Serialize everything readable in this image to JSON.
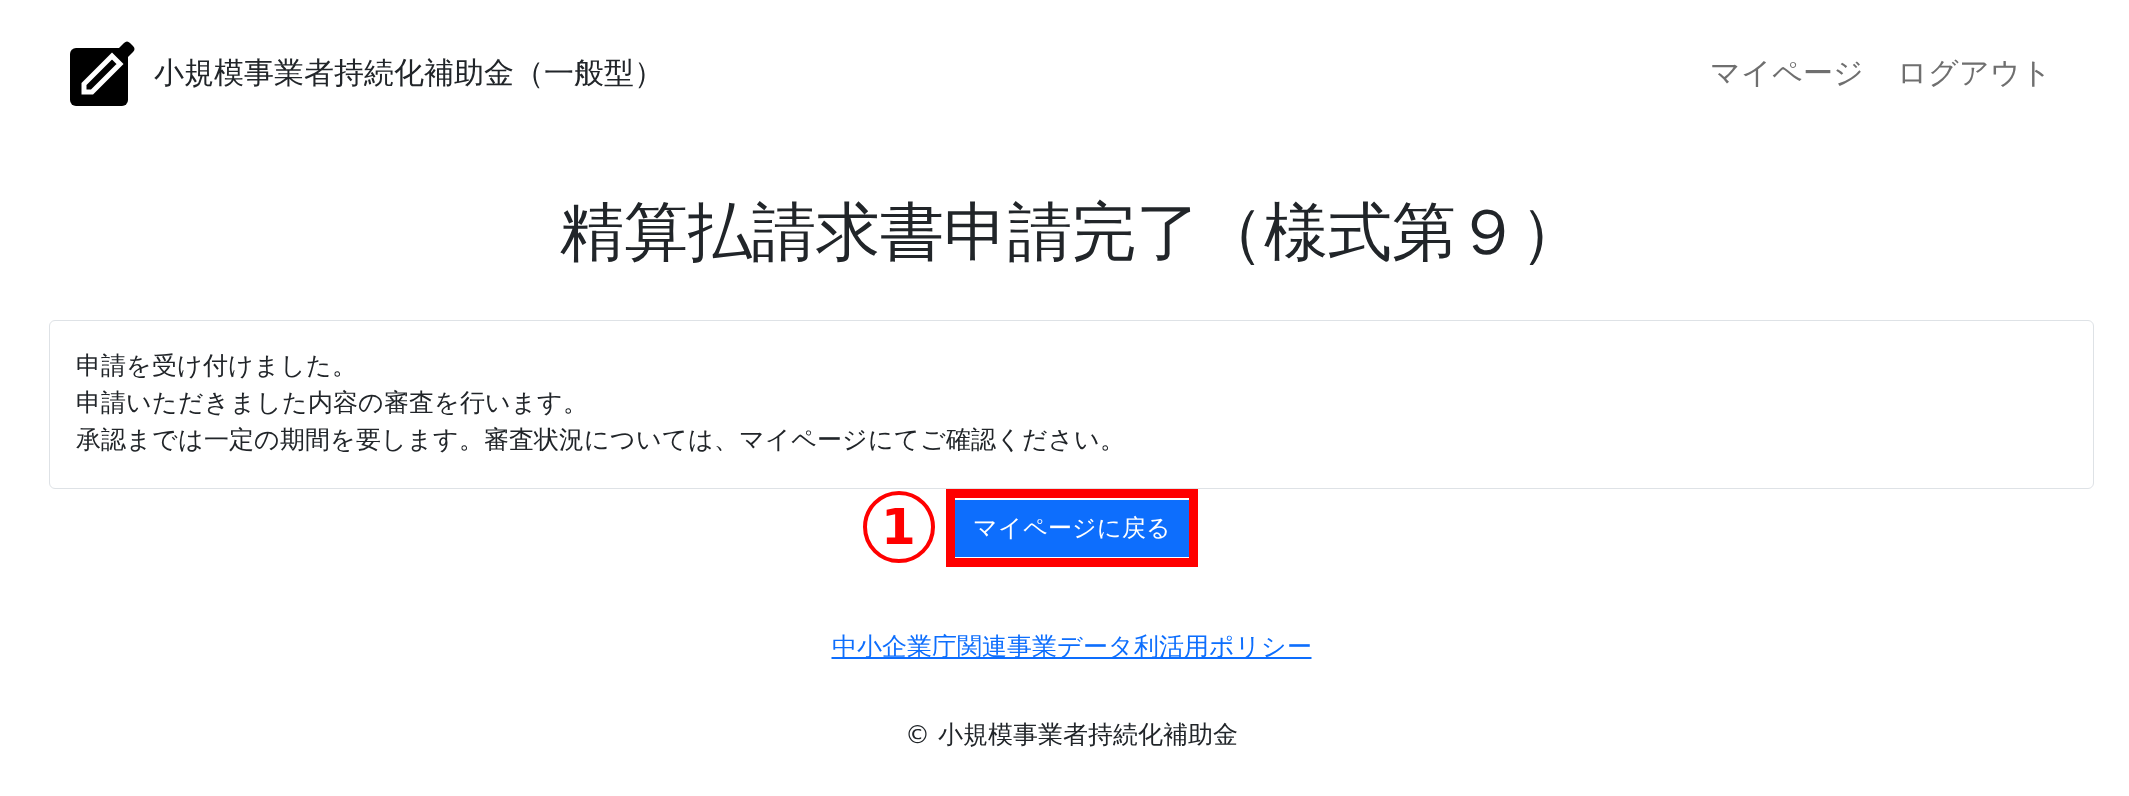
{
  "header": {
    "title": "小規模事業者持続化補助金（一般型）",
    "nav": [
      {
        "label": "マイページ"
      },
      {
        "label": "ログアウト"
      }
    ]
  },
  "page_title": "精算払請求書申請完了（様式第９）",
  "message": {
    "lines": [
      "申請を受け付けました。",
      "申請いただきました内容の審査を行います。",
      "承認までは一定の期間を要します。審査状況については、マイページにてご確認ください。"
    ]
  },
  "back_button": {
    "label": "マイページに戻る",
    "highlighted": true,
    "step_marker": "1"
  },
  "footer": {
    "link": "中小企業庁関連事業データ利活用ポリシー",
    "copyright": "© 小規模事業者持続化補助金"
  }
}
